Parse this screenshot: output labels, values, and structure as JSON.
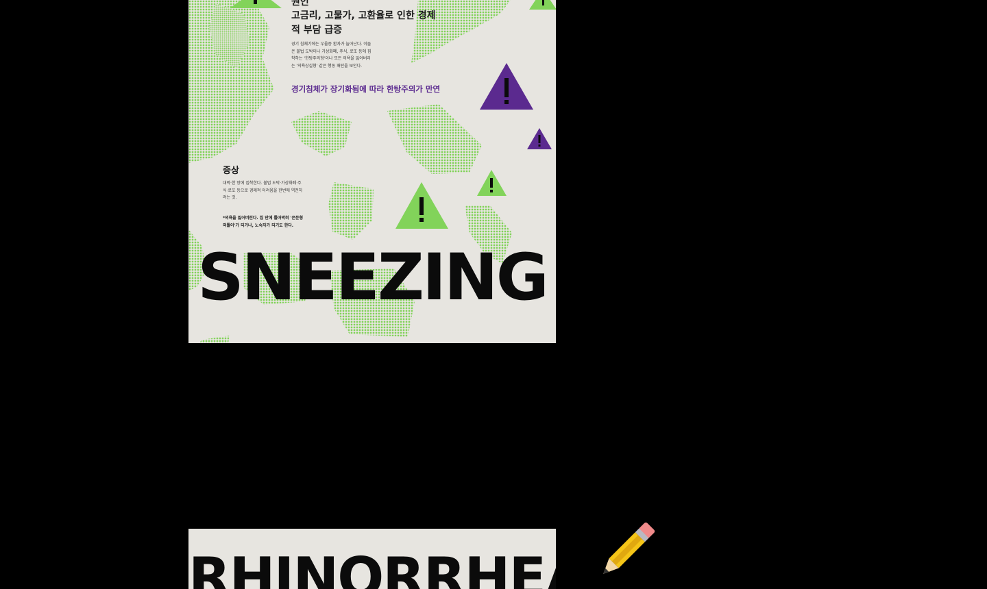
{
  "poster_top": {
    "cause": {
      "heading": "원인",
      "title": "고금리, 고물가, 고환율로 인한 경제적 부담 급증",
      "body": "경기 침체기에는 우울증 환자가 늘어난다. 이들은 불법 도박이나 가상화폐, 주식, 로또 등에 집착하는 '한탕주의형'이나 모든 의욕을 잃어버리는 '의욕상실형' 같은 행동 패턴을 보인다.",
      "highlight": "경기침체가 장기화됨에 따라 한탕주의가 만연"
    },
    "symptom": {
      "heading": "증상",
      "body": "대박·한 방에 집착한다. 불법 도박·가상화폐·주식·로또 등으로 경제적 어려움을 한번에 역전하려는 것.",
      "note": "*의욕을 잃어버린다. 집 안에 틀어박혀 '은둔형 외톨이'가 되거나, 노숙자가 되기도 한다."
    },
    "big_word": "SNEEZING"
  },
  "poster_bottom": {
    "big_word": "RHINORRHEA"
  },
  "colors": {
    "background": "#000000",
    "poster": "#e7e5e0",
    "green": "#82d35a",
    "purple": "#5b2a8f",
    "ink": "#0b0b0b"
  },
  "icons": {
    "warning": "warning-triangle-icon",
    "edit": "pencil-icon"
  }
}
